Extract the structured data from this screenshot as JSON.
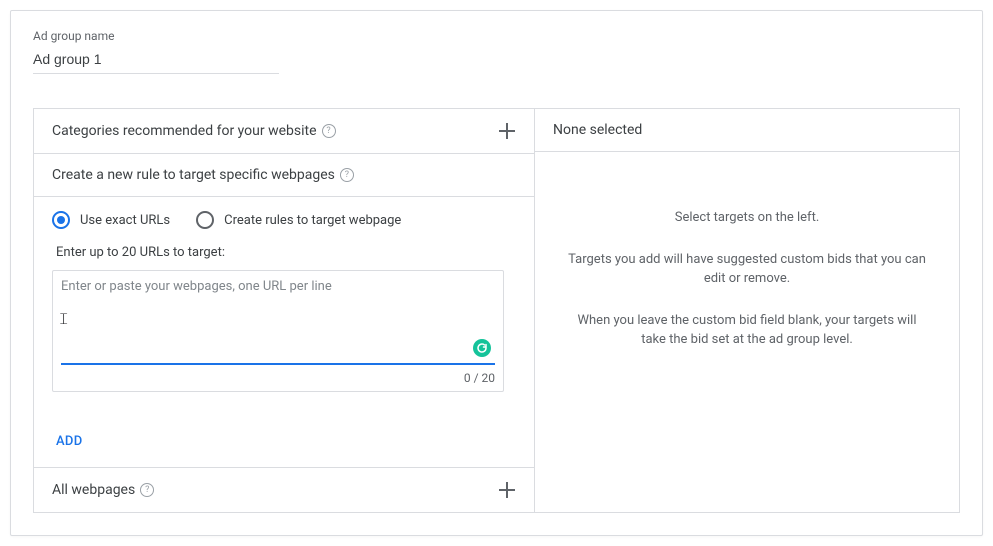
{
  "adGroup": {
    "label": "Ad group name",
    "value": "Ad group 1"
  },
  "leftPanel": {
    "categories": {
      "title": "Categories recommended for your website"
    },
    "createRule": {
      "title": "Create a new rule to target specific webpages",
      "radioExact": "Use exact URLs",
      "radioRules": "Create rules to target webpage",
      "enterUrlsLabel": "Enter up to 20 URLs to target:",
      "placeholder": "Enter or paste your webpages, one URL per line",
      "counter": "0 / 20",
      "addButton": "ADD"
    },
    "allWebpages": {
      "title": "All webpages"
    }
  },
  "rightPanel": {
    "header": "None selected",
    "line1": "Select targets on the left.",
    "line2": "Targets you add will have suggested custom bids that you can edit or remove.",
    "line3": "When you leave the custom bid field blank, your targets will take the bid set at the ad group level."
  }
}
